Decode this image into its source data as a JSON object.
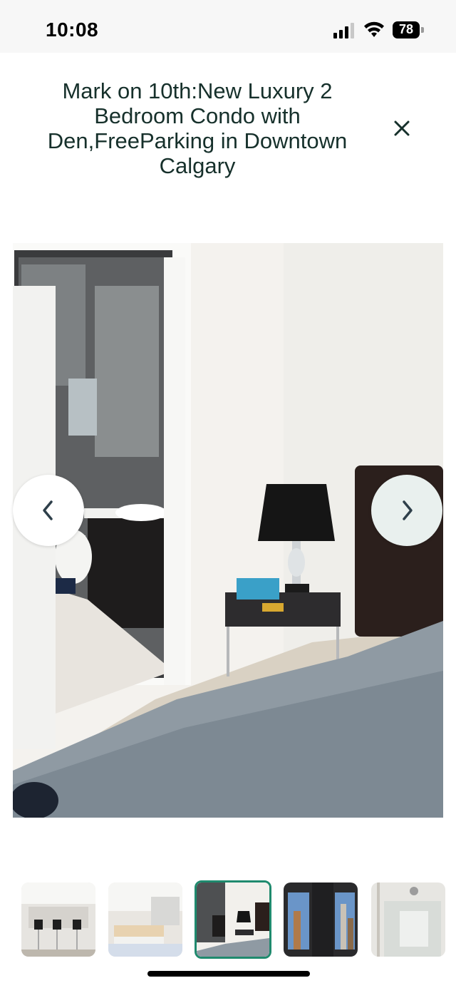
{
  "status_bar": {
    "time": "10:08",
    "battery": "78",
    "icons": [
      "signal-icon",
      "wifi-icon",
      "battery-icon"
    ]
  },
  "header": {
    "title": "Mark on 10th:New Luxury 2 Bedroom Condo with Den,FreeParking in Downtown Calgary",
    "close_icon": "close-icon"
  },
  "gallery": {
    "prev_icon": "chevron-left-icon",
    "next_icon": "chevron-right-icon",
    "thumbnails": [
      {
        "name": "kitchen-bar-stools",
        "active": false
      },
      {
        "name": "kitchen-island",
        "active": false
      },
      {
        "name": "bedroom-ensuite",
        "active": true
      },
      {
        "name": "window-city-view",
        "active": false
      },
      {
        "name": "shower",
        "active": false
      }
    ]
  },
  "colors": {
    "accent": "#1f8a6e",
    "title": "#16302b",
    "status_bar_bg": "#f7f7f7"
  }
}
